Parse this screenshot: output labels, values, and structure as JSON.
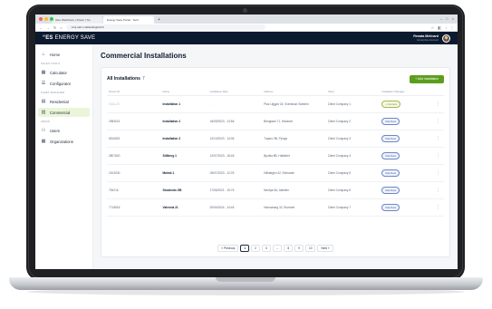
{
  "browser": {
    "tabs": [
      "Glex Welshiture | Power | Tre",
      "Energy Save Portal - Tech"
    ],
    "url": "cms.usb.c.ukl/settings/cmh"
  },
  "app": {
    "logo_mark": "“ES",
    "logo_text": "ENERGY SAVE",
    "user_name": "Renata Melinard",
    "user_role": "Enterprise Account"
  },
  "sidebar": {
    "home": "Home",
    "section_sales": "SALES TOOLS",
    "calculator": "Calculator",
    "configurator": "Configurator",
    "section_fleet": "FLEET MANAGER",
    "residential": "Residential",
    "commercial": "Commercial",
    "section_admin": "ADMIN",
    "users": "Users",
    "organizations": "Organizations"
  },
  "page": {
    "title": "Commercial Installations",
    "card_title": "All Installations",
    "card_count": "7",
    "add_button": "+ Add Installation"
  },
  "table": {
    "columns": [
      "Device ID",
      "Name",
      "Installation Date",
      "Address",
      "Client",
      "Installation Manager"
    ],
    "rows": [
      {
        "id": "0014-23",
        "name": "Installation 1",
        "date": "-",
        "address": "Plac Liljgyol 24, Svendsun Sweden",
        "client": "Client Company 1",
        "manager": "+ Connect",
        "manager_type": "connect",
        "muted": true
      },
      {
        "id": "2984021",
        "name": "Installation 2",
        "date": "16/09/2023 - 13:56",
        "address": "Bengtaan 71, Moskvet",
        "client": "Client Company 2",
        "manager": "Stat.Nora",
        "manager_type": "user"
      },
      {
        "id": "6510802",
        "name": "Installation 3",
        "date": "12/10/2023 - 14:06",
        "address": "Tuparo 5B, Flyngs",
        "client": "Client Company 3",
        "manager": "Stat.Nora",
        "manager_type": "user"
      },
      {
        "id": "2807620",
        "name": "Stillberg 1",
        "date": "12/07/2023 - 18:45",
        "address": "Bjorkla 8B, Hallsfeet",
        "client": "Client Company 4",
        "manager": "Stat.Nora",
        "manager_type": "user"
      },
      {
        "id": "1513030",
        "name": "Malmö 1",
        "date": "05/07/2023 - 12:25",
        "address": "Håldalgen 42, Ekelunde",
        "client": "Client Company 5",
        "manager": "Stat.Nora",
        "manager_type": "user"
      },
      {
        "id": "754216",
        "name": "Sboshnäs GB",
        "date": "17/06/2021 - 15:75",
        "address": "Nerrtjal 5A, Aktellen",
        "client": "Client Company 6",
        "manager": "Stat.Nora",
        "manager_type": "user"
      },
      {
        "id": "7716515",
        "name": "Valencia 21",
        "date": "20/04/2024 - 14:45",
        "address": "Harnamarg 32, Rumsert",
        "client": "Client Company 7",
        "manager": "Stat.Nora",
        "manager_type": "user"
      }
    ]
  },
  "pagination": {
    "previous": "« Previous",
    "pages": [
      "1",
      "2",
      "3",
      "...",
      "8",
      "9",
      "10"
    ],
    "active": "1",
    "next": "Next »"
  },
  "colors": {
    "header_bg": "#0b1a2e",
    "accent_green": "#5d9d1e",
    "active_nav_bg": "#eaf5d9",
    "laptop_body": "#1f2023"
  },
  "icons": {
    "home": "home-icon",
    "calculator": "calculator-icon",
    "configurator": "configurator-icon",
    "residential": "residential-icon",
    "commercial": "commercial-icon",
    "users": "users-icon",
    "organizations": "organizations-icon"
  }
}
